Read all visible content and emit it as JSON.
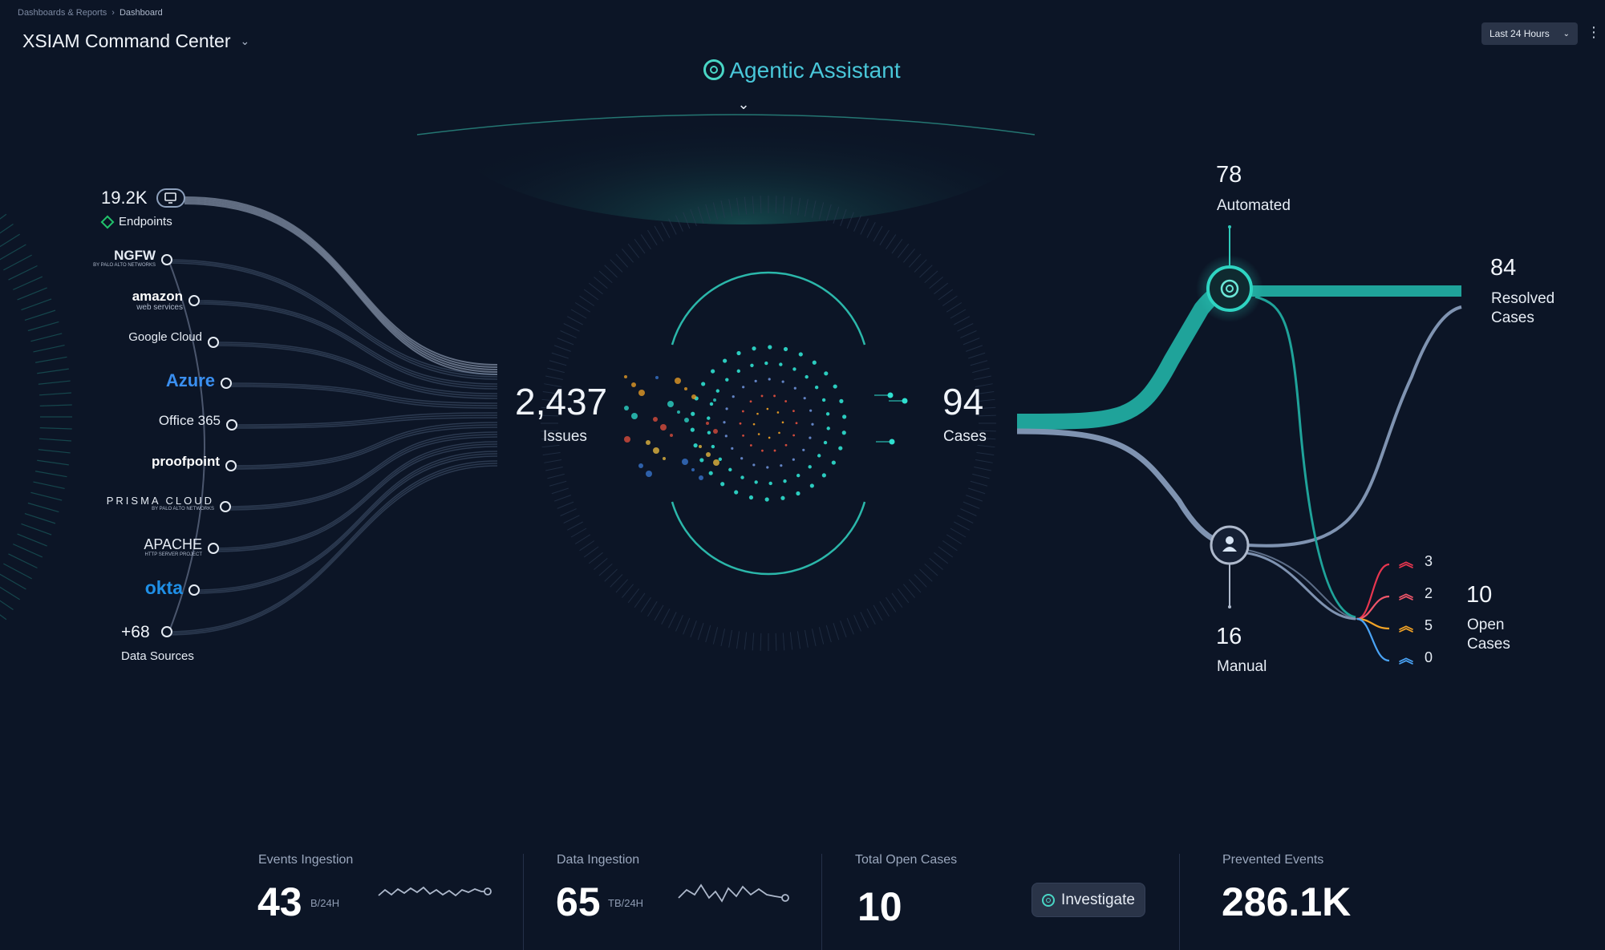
{
  "breadcrumb": {
    "parent": "Dashboards & Reports",
    "separator": "›",
    "current": "Dashboard"
  },
  "header": {
    "title": "XSIAM Command Center",
    "time_range": "Last 24 Hours"
  },
  "assistant": {
    "label": "Agentic Assistant"
  },
  "sources": {
    "endpoints": {
      "value": "19.2K",
      "label": "Endpoints"
    },
    "items": [
      {
        "name": "NGFW",
        "sub": "BY PALO ALTO NETWORKS",
        "color": "#e6ecf4"
      },
      {
        "name": "amazon",
        "sub": "web services",
        "color": "#ffffff"
      },
      {
        "name": "Google Cloud",
        "sub": "",
        "color": "#e6ecf4"
      },
      {
        "name": "Azure",
        "sub": "",
        "color": "#3a8ff0"
      },
      {
        "name": "Office 365",
        "sub": "",
        "color": "#e6ecf4"
      },
      {
        "name": "proofpoint",
        "sub": "",
        "color": "#ffffff"
      },
      {
        "name": "PRISMA CLOUD",
        "sub": "BY PALO ALTO NETWORKS",
        "color": "#e6ecf4"
      },
      {
        "name": "APACHE",
        "sub": "HTTP SERVER PROJECT",
        "color": "#e6ecf4"
      },
      {
        "name": "okta",
        "sub": "",
        "color": "#1f8fe6"
      }
    ],
    "more": {
      "value": "+68",
      "label": "Data Sources"
    }
  },
  "issues": {
    "value": "2,437",
    "label": "Issues"
  },
  "cases": {
    "value": "94",
    "label": "Cases"
  },
  "automated": {
    "value": "78",
    "label": "Automated"
  },
  "manual": {
    "value": "16",
    "label": "Manual"
  },
  "resolved": {
    "value": "84",
    "label_line1": "Resolved",
    "label_line2": "Cases"
  },
  "open_cases": {
    "value": "10",
    "label_line1": "Open",
    "label_line2": "Cases",
    "priorities": [
      {
        "count": "3",
        "color": "#e8364f"
      },
      {
        "count": "2",
        "color": "#f0566a"
      },
      {
        "count": "5",
        "color": "#f2a326"
      },
      {
        "count": "0",
        "color": "#4aa3f5"
      }
    ]
  },
  "stats": {
    "events_ingestion": {
      "label": "Events Ingestion",
      "value": "43",
      "unit": "B/24H"
    },
    "data_ingestion": {
      "label": "Data Ingestion",
      "value": "65",
      "unit": "TB/24H"
    },
    "total_open_cases": {
      "label": "Total Open Cases",
      "value": "10",
      "button": "Investigate"
    },
    "prevented_events": {
      "label": "Prevented Events",
      "value": "286.1K"
    }
  },
  "colors": {
    "teal": "#1fa39a",
    "slate": "#7f93b1",
    "accent": "#49d6c5"
  }
}
